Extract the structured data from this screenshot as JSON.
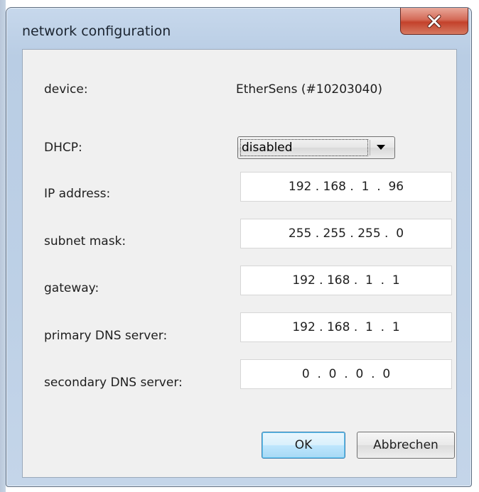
{
  "window": {
    "title": "network configuration"
  },
  "form": {
    "device": {
      "label": "device:",
      "value": "EtherSens (#10203040)"
    },
    "dhcp": {
      "label": "DHCP:",
      "selected": "disabled"
    },
    "ip_address": {
      "label": "IP address:",
      "value": "192 . 168 .  1  .  96"
    },
    "subnet_mask": {
      "label": "subnet mask:",
      "value": "255 . 255 . 255 .  0"
    },
    "gateway": {
      "label": "gateway:",
      "value": "192 . 168 .  1  .  1"
    },
    "primary_dns": {
      "label": "primary DNS server:",
      "value": "192 . 168 .  1  .  1"
    },
    "secondary_dns": {
      "label": "secondary DNS server:",
      "value": "0  .  0  .  0  .  0"
    }
  },
  "buttons": {
    "ok": "OK",
    "cancel": "Abbrechen"
  },
  "icons": {
    "close": "close-icon",
    "dropdown": "chevron-down-icon"
  }
}
